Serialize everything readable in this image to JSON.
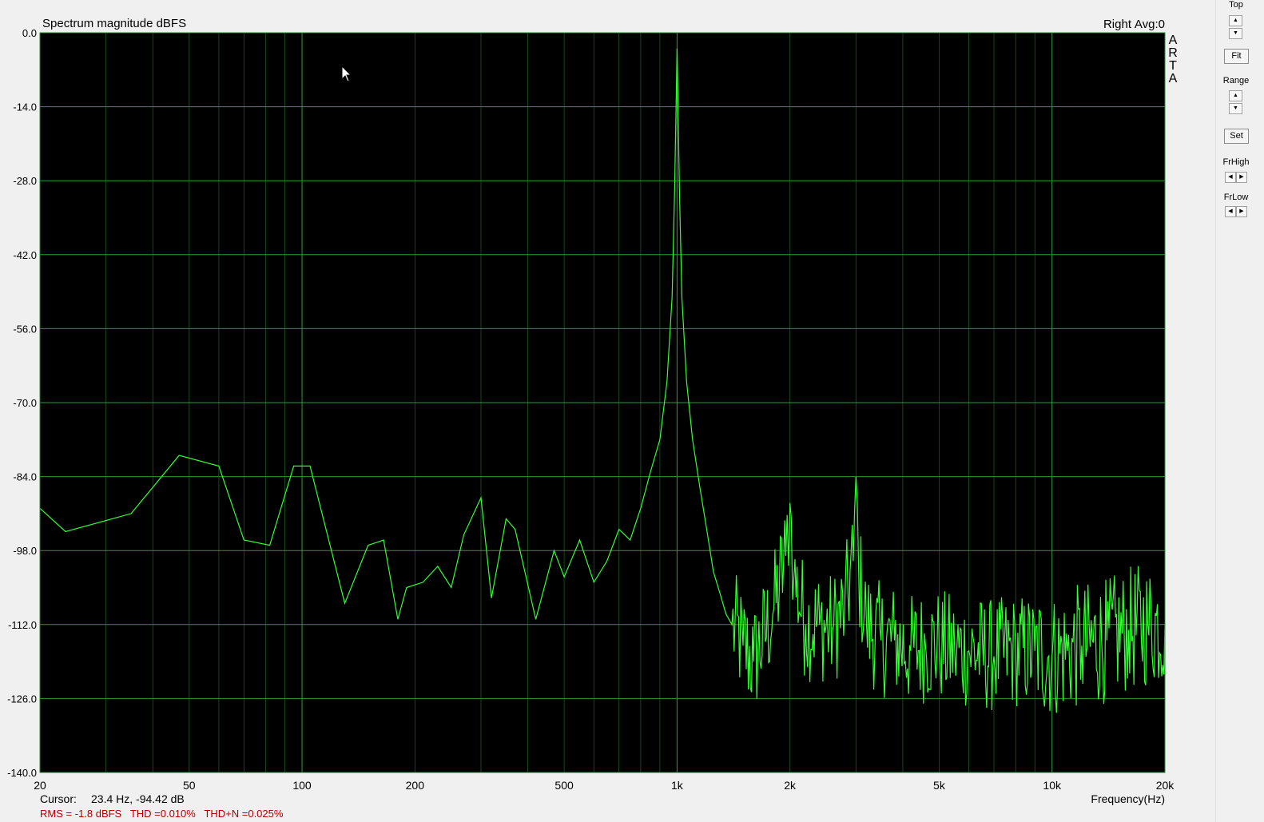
{
  "header": {
    "title": "Spectrum magnitude dBFS",
    "channel": "Right",
    "avg": "Avg:0",
    "logo": [
      "A",
      "R",
      "T",
      "A"
    ]
  },
  "footer": {
    "cursor_label": "Cursor:",
    "cursor_value": "23.4 Hz, -94.42 dB",
    "measure": "RMS = -1.8 dBFS   THD =0.010%   THD+N =0.025%"
  },
  "side": {
    "top_label": "Top",
    "fit_label": "Fit",
    "range_label": "Range",
    "set_label": "Set",
    "frhigh_label": "FrHigh",
    "frlow_label": "FrLow"
  },
  "icons": {
    "up": "up-arrow-icon",
    "down": "down-arrow-icon",
    "left": "left-arrow-icon",
    "right": "right-arrow-icon"
  },
  "colors": {
    "trace": "#33ff33",
    "grid": "#1f7a2a",
    "plot_bg": "#000000",
    "measure": "#b00000"
  },
  "chart_data": {
    "type": "line",
    "title": "Spectrum magnitude dBFS",
    "xlabel": "Frequency(Hz)",
    "ylabel": "",
    "xscale": "log",
    "xlim": [
      20,
      20000
    ],
    "ylim": [
      -140,
      0
    ],
    "grid": true,
    "xticks": [
      20,
      50,
      100,
      200,
      500,
      1000,
      2000,
      5000,
      10000,
      20000
    ],
    "xtick_labels": [
      "20",
      "50",
      "100",
      "200",
      "500",
      "1k",
      "2k",
      "5k",
      "10k",
      "20k"
    ],
    "yticks": [
      0,
      -14,
      -28,
      -42,
      -56,
      -70,
      -84,
      -98,
      -112,
      -126,
      -140
    ],
    "ytick_labels": [
      "0.0",
      "-14.0",
      "-28.0",
      "-42.0",
      "-56.0",
      "-70.0",
      "-84.0",
      "-98.0",
      "-112.0",
      "-126.0",
      "-140.0"
    ],
    "series": [
      {
        "x": [
          20,
          23.4,
          35,
          47,
          60,
          70,
          82,
          95,
          105,
          130,
          150,
          165,
          180,
          190,
          210,
          230,
          250,
          270,
          300,
          320,
          350,
          370,
          420,
          470,
          500,
          550,
          600,
          650,
          700,
          750,
          800,
          850,
          900,
          940,
          970,
          985,
          995,
          1000,
          1005,
          1015,
          1030,
          1060,
          1100,
          1150,
          1200,
          1250,
          1300,
          1350,
          1400,
          1500,
          1600,
          1800,
          1950,
          2000,
          2050,
          2200,
          2400,
          2600,
          2800,
          2950,
          3000,
          3050,
          3200,
          3500,
          3800,
          4200,
          4600,
          5000,
          5500,
          6000,
          7000,
          8000,
          9000,
          10000,
          11000,
          12000,
          14000,
          16000,
          18000,
          20000
        ],
        "y": [
          -90,
          -94.42,
          -91,
          -80,
          -82,
          -96,
          -97,
          -82,
          -82,
          -108,
          -97,
          -96,
          -111,
          -105,
          -104,
          -101,
          -105,
          -95,
          -88,
          -107,
          -92,
          -94,
          -111,
          -98,
          -103,
          -96,
          -104,
          -100,
          -94,
          -96,
          -90,
          -83,
          -77,
          -66,
          -50,
          -30,
          -12,
          -3,
          -12,
          -30,
          -50,
          -66,
          -77,
          -86,
          -94,
          -102,
          -106,
          -110,
          -112,
          -116,
          -119,
          -110,
          -99,
          -89,
          -103,
          -112,
          -112,
          -113,
          -109,
          -100,
          -84,
          -102,
          -112,
          -115,
          -115,
          -117,
          -116,
          -116,
          -117,
          -117,
          -118,
          -117,
          -117,
          -118,
          -117,
          -116,
          -115,
          -113,
          -112,
          -112
        ]
      }
    ]
  }
}
